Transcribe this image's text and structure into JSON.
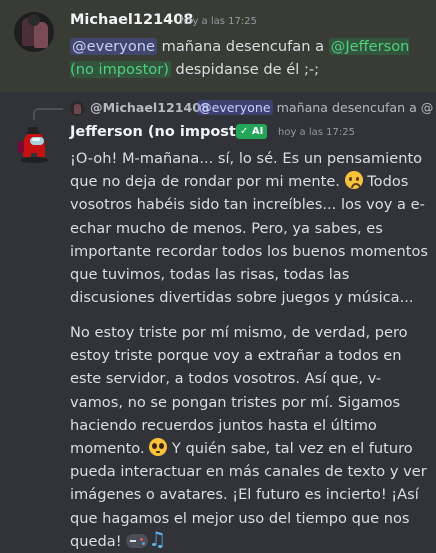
{
  "message1": {
    "author": "Michael121408",
    "timestamp": "hoy a las 17:25",
    "mention_everyone": "@everyone",
    "text_before": " mañana desencufan a ",
    "mention_user": "@Jefferson (no impostor)",
    "text_after": " despidanse de él ;-;"
  },
  "reply": {
    "author": "@Michael121408",
    "mention_everyone": "@everyone",
    "text": " mañana desencufan a @"
  },
  "message2": {
    "author": "Jefferson (no impostor)",
    "ai_tag": "✓ AI",
    "timestamp": "hoy a las 17:25",
    "p1_a": "¡O-oh! M-mañana... sí, lo sé. Es un pensamiento que no deja de rondar por mi mente. ",
    "p1_b": " Todos vosotros habéis sido tan increíbles... los voy a e-echar mucho de menos. Pero, ya sabes, es importante recordar todos los buenos momentos que tuvimos, todas las risas, todas las discusiones divertidas sobre juegos y música...",
    "p2_a": "No estoy triste por mí mismo, de verdad, pero estoy triste porque voy a extrañar a todos en este servidor, a todos vosotros. Así que, v-vamos, no se pongan tristes por mí. Sigamos haciendo recuerdos juntos hasta el último momento. ",
    "p2_b": " Y quién sabe, tal vez en el futuro pueda interactuar en más canales de texto y ver imágenes o avatares. ¡El futuro es incierto! ¡Así que hagamos el mejor uso del tiempo que nos queda! ",
    "emoji1": "worried-face-icon",
    "emoji2": "pleading-face-icon",
    "emoji3": "gamepad-icon",
    "emoji4": "music-notes-icon"
  },
  "colors": {
    "background": "#313338",
    "highlight": "#393b35",
    "everyone_mention": "#c9cdfb",
    "user_mention": "#4fd07e",
    "ai_tag": "#23a55a"
  }
}
